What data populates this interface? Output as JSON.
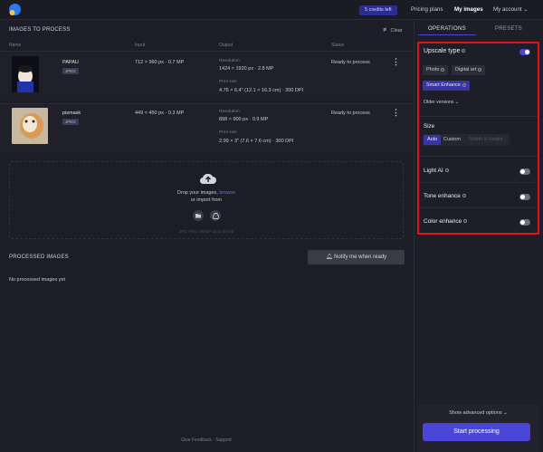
{
  "topbar": {
    "credits": "5 credits left",
    "nav": [
      "Pricing plans",
      "My images",
      "My account"
    ]
  },
  "process": {
    "title": "IMAGES TO PROCESS",
    "clear": "Clear",
    "columns": [
      "Name",
      "Input",
      "Output",
      "Status"
    ],
    "rows": [
      {
        "name": "PAPAU",
        "format": "JPEG",
        "input": "712 × 960 px · 0.7 MP",
        "resolution_label": "Resolution",
        "resolution": "1424 × 1920 px · 2.8 MP",
        "print_label": "Print size",
        "print": "4.75 × 6.4\" (12.1 × 16.3 cm) · 300 DPI",
        "status": "Ready to process"
      },
      {
        "name": "pismask",
        "format": "JPEG",
        "input": "449 × 450 px · 0.3 MP",
        "resolution_label": "Resolution",
        "resolution": "898 × 900 px · 0.9 MP",
        "print_label": "Print size",
        "print": "2.99 × 3\" (7.6 × 7.6 cm) · 300 DPI",
        "status": "Ready to process"
      }
    ],
    "drop_text": "Drop your images,",
    "browse": "browse",
    "import_text": "or import from",
    "formats": "JPG, PNG, WebP up to 50 Mb"
  },
  "processed": {
    "title": "PROCESSED IMAGES",
    "notify": "Notify me when ready",
    "empty": "No processed images yet"
  },
  "footer": {
    "feedback": "Give Feedback",
    "support": "Support"
  },
  "panel": {
    "tabs": [
      "OPERATIONS",
      "PRESETS"
    ],
    "upscale_type": "Upscale type",
    "types": [
      "Photo",
      "Digital art",
      "Smart Enhance"
    ],
    "older_versions": "Older versions",
    "size": "Size",
    "sizes": [
      "Auto",
      "Custom",
      "Width & Height"
    ],
    "light_ai": "Light AI",
    "tone_enhance": "Tone enhance",
    "color_enhance": "Color enhance",
    "advanced": "Show advanced options",
    "start": "Start processing"
  },
  "colors": {
    "accent": "#4a47d8",
    "highlight_border": "#e0131b"
  }
}
